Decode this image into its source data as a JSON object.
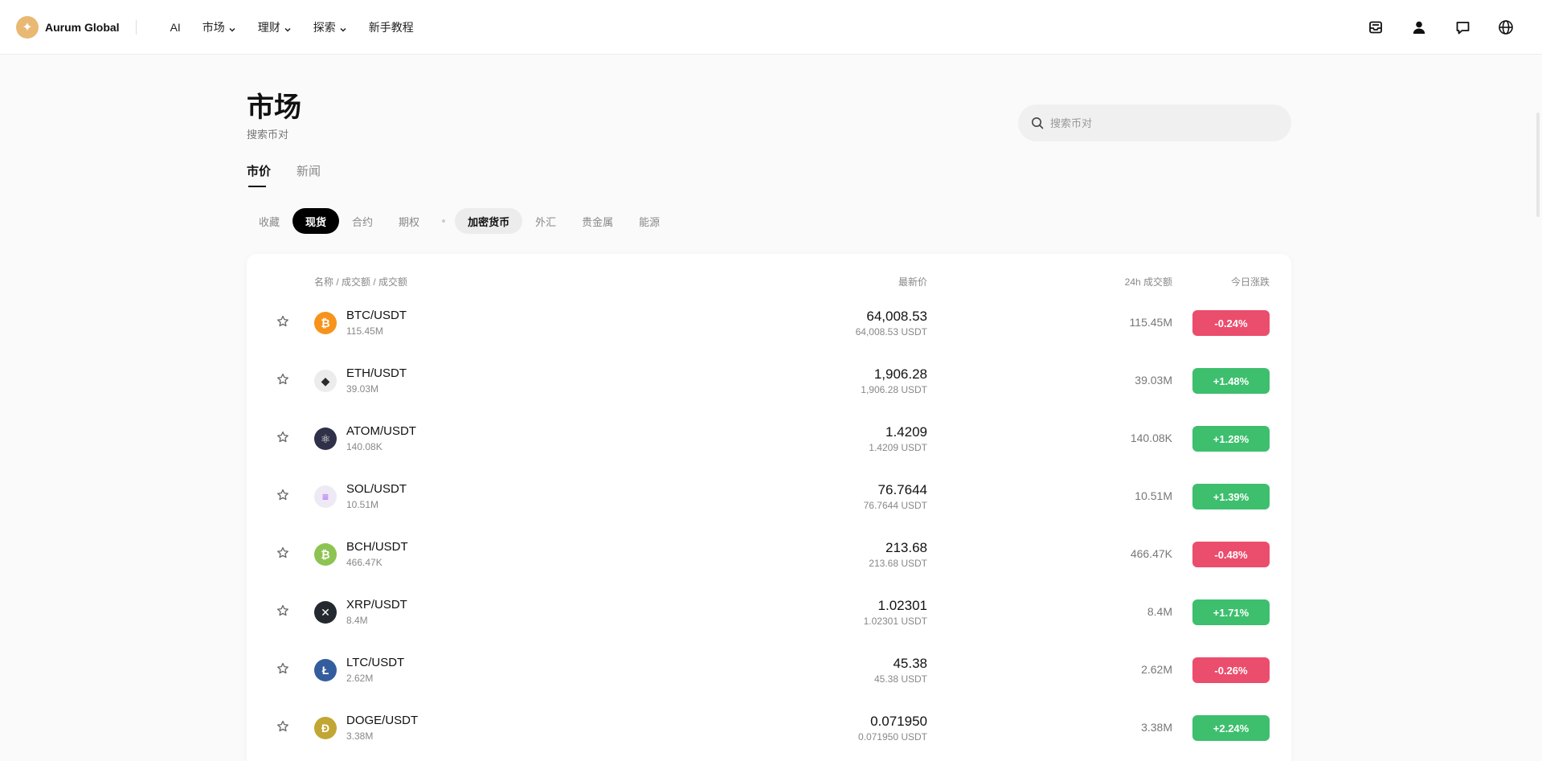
{
  "brand": {
    "name": "Aurum Global",
    "logo_glyph": "✦",
    "logo_color": "#e9b873"
  },
  "nav": [
    {
      "label": "AI",
      "dropdown": false
    },
    {
      "label": "市场",
      "dropdown": true
    },
    {
      "label": "理财",
      "dropdown": true
    },
    {
      "label": "探索",
      "dropdown": true
    },
    {
      "label": "新手教程",
      "dropdown": false
    }
  ],
  "top_icons": [
    "inbox-icon",
    "user-icon",
    "chat-icon",
    "globe-icon"
  ],
  "page": {
    "title": "市场",
    "subtitle": "搜索币对"
  },
  "search": {
    "placeholder": "搜索币对",
    "value": ""
  },
  "main_tabs": [
    {
      "label": "市价",
      "active": true
    },
    {
      "label": "新闻",
      "active": false
    }
  ],
  "filters": {
    "left": [
      {
        "label": "收藏",
        "state": ""
      },
      {
        "label": "现货",
        "state": "active-dark"
      },
      {
        "label": "合约",
        "state": ""
      },
      {
        "label": "期权",
        "state": ""
      }
    ],
    "right": [
      {
        "label": "加密货币",
        "state": "active-light"
      },
      {
        "label": "外汇",
        "state": ""
      },
      {
        "label": "贵金属",
        "state": ""
      },
      {
        "label": "能源",
        "state": ""
      }
    ]
  },
  "table": {
    "headers": {
      "name": "名称 / 成交额 / 成交额",
      "price": "最新价",
      "volume": "24h 成交额",
      "change": "今日涨跌"
    },
    "colors": {
      "up": "#3dbf6e",
      "down": "#eb4d6d"
    },
    "rows": [
      {
        "pair": "BTC/USDT",
        "sub_volume": "115.45M",
        "price": "64,008.53",
        "price_usdt": "64,008.53 USDT",
        "volume": "115.45M",
        "change": "-0.24%",
        "direction": "down",
        "coin": {
          "glyph": "₿",
          "bg": "#f7931a",
          "fg": "#ffffff"
        }
      },
      {
        "pair": "ETH/USDT",
        "sub_volume": "39.03M",
        "price": "1,906.28",
        "price_usdt": "1,906.28 USDT",
        "volume": "39.03M",
        "change": "+1.48%",
        "direction": "up",
        "coin": {
          "glyph": "◆",
          "bg": "#ececec",
          "fg": "#2b2b2b"
        }
      },
      {
        "pair": "ATOM/USDT",
        "sub_volume": "140.08K",
        "price": "1.4209",
        "price_usdt": "1.4209 USDT",
        "volume": "140.08K",
        "change": "+1.28%",
        "direction": "up",
        "coin": {
          "glyph": "⚛",
          "bg": "#2e3148",
          "fg": "#ffffff"
        }
      },
      {
        "pair": "SOL/USDT",
        "sub_volume": "10.51M",
        "price": "76.7644",
        "price_usdt": "76.7644 USDT",
        "volume": "10.51M",
        "change": "+1.39%",
        "direction": "up",
        "coin": {
          "glyph": "≡",
          "bg": "#eeeaf5",
          "fg": "#9945ff"
        }
      },
      {
        "pair": "BCH/USDT",
        "sub_volume": "466.47K",
        "price": "213.68",
        "price_usdt": "213.68 USDT",
        "volume": "466.47K",
        "change": "-0.48%",
        "direction": "down",
        "coin": {
          "glyph": "₿",
          "bg": "#8dc351",
          "fg": "#ffffff"
        }
      },
      {
        "pair": "XRP/USDT",
        "sub_volume": "8.4M",
        "price": "1.02301",
        "price_usdt": "1.02301 USDT",
        "volume": "8.4M",
        "change": "+1.71%",
        "direction": "up",
        "coin": {
          "glyph": "✕",
          "bg": "#23292f",
          "fg": "#ffffff"
        }
      },
      {
        "pair": "LTC/USDT",
        "sub_volume": "2.62M",
        "price": "45.38",
        "price_usdt": "45.38 USDT",
        "volume": "2.62M",
        "change": "-0.26%",
        "direction": "down",
        "coin": {
          "glyph": "Ł",
          "bg": "#345d9d",
          "fg": "#ffffff"
        }
      },
      {
        "pair": "DOGE/USDT",
        "sub_volume": "3.38M",
        "price": "0.071950",
        "price_usdt": "0.071950 USDT",
        "volume": "3.38M",
        "change": "+2.24%",
        "direction": "up",
        "coin": {
          "glyph": "Ð",
          "bg": "#c2a633",
          "fg": "#ffffff"
        }
      }
    ]
  }
}
